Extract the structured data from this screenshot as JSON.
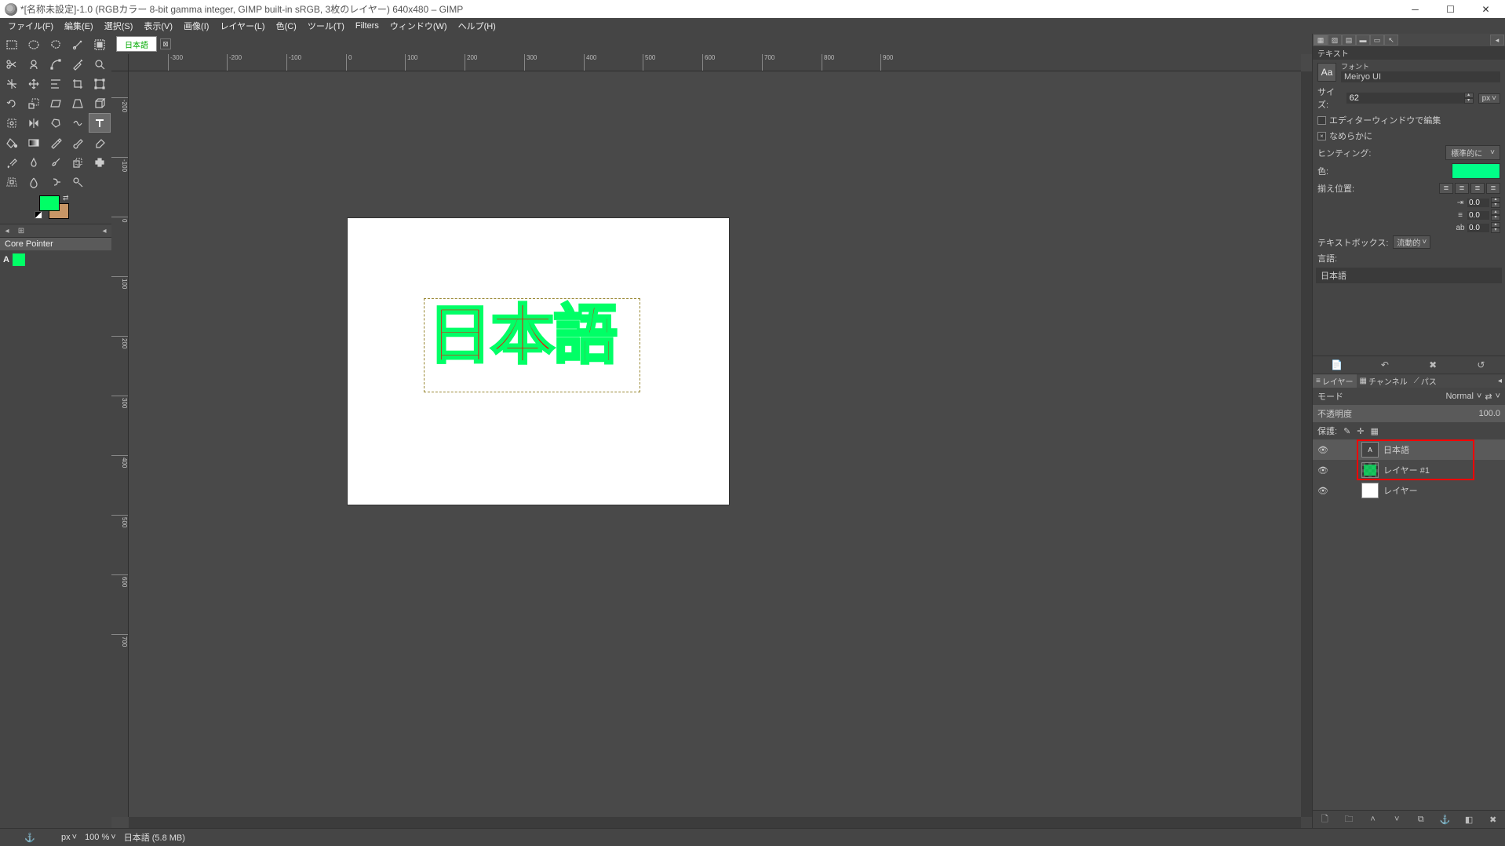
{
  "title": "*[名称未設定]-1.0 (RGBカラー 8-bit gamma integer, GIMP built-in sRGB, 3枚のレイヤー) 640x480 – GIMP",
  "menus": [
    "ファイル(F)",
    "編集(E)",
    "選択(S)",
    "表示(V)",
    "画像(I)",
    "レイヤー(L)",
    "色(C)",
    "ツール(T)",
    "Filters",
    "ウィンドウ(W)",
    "ヘルプ(H)"
  ],
  "doc_tab": "日本語",
  "ruler_marks_h": [
    "-300",
    "-200",
    "-100",
    "0",
    "100",
    "200",
    "300",
    "400",
    "500",
    "600",
    "700",
    "800",
    "900"
  ],
  "ruler_marks_v": [
    "-200",
    "-100",
    "0",
    "100",
    "200",
    "300",
    "400",
    "500",
    "600",
    "700"
  ],
  "canvas_text": "日本語",
  "toolbox": {
    "core_pointer": "Core Pointer"
  },
  "status": {
    "unit": "px",
    "zoom": "100 %",
    "info": "日本語 (5.8 MB)"
  },
  "text_panel": {
    "title": "テキスト",
    "font_label": "フォント",
    "font_name": "Meiryo UI",
    "size_label": "サイズ:",
    "size_value": "62",
    "size_unit": "px",
    "use_editor": "エディターウィンドウで編集",
    "antialias": "なめらかに",
    "hinting_label": "ヒンティング:",
    "hinting_value": "標準的に",
    "color_label": "色:",
    "justify_label": "揃え位置:",
    "indent_value": "0.0",
    "line_value": "0.0",
    "letter_value": "0.0",
    "textbox_label": "テキストボックス:",
    "textbox_value": "流動的",
    "lang_label": "言語:",
    "lang_value": "日本語"
  },
  "layers_panel": {
    "tab_layers": "レイヤー",
    "tab_channels": "チャンネル",
    "tab_paths": "パス",
    "mode_label": "モード",
    "mode_value": "Normal",
    "opacity_label": "不透明度",
    "opacity_value": "100.0",
    "lock_label": "保護:",
    "layers": [
      {
        "name": "日本語",
        "type": "text",
        "visible": true
      },
      {
        "name": "レイヤー #1",
        "type": "alpha",
        "visible": true
      },
      {
        "name": "レイヤー",
        "type": "white",
        "visible": true
      }
    ]
  }
}
